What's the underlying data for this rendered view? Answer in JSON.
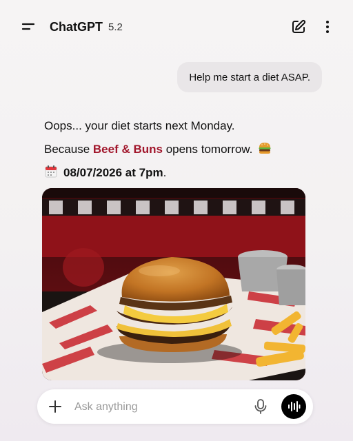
{
  "header": {
    "app_name": "ChatGPT",
    "version": "5.2",
    "icons": {
      "menu": "menu-icon",
      "new_chat": "edit-icon",
      "more": "more-vertical-icon"
    }
  },
  "conversation": {
    "user_message": "Help me start a diet ASAP.",
    "assistant": {
      "line1": "Oops... your diet starts next Monday.",
      "line2_before": "Because ",
      "line2_brand": "Beef & Buns",
      "line2_after": " opens tomorrow.",
      "line2_emoji": "hamburger-emoji",
      "line3_emoji": "calendar-emoji",
      "line3_date": "08/07/2026 at 7pm",
      "line3_end": "."
    },
    "image": {
      "subject": "cheeseburger-with-fries"
    }
  },
  "composer": {
    "placeholder": "Ask anything",
    "value": "",
    "icons": {
      "add": "plus-icon",
      "mic": "mic-icon",
      "voice": "voice-waveform-icon"
    }
  },
  "colors": {
    "brand_accent": "#a1162b",
    "bubble": "#e9e6e8",
    "voice_button": "#000000"
  }
}
